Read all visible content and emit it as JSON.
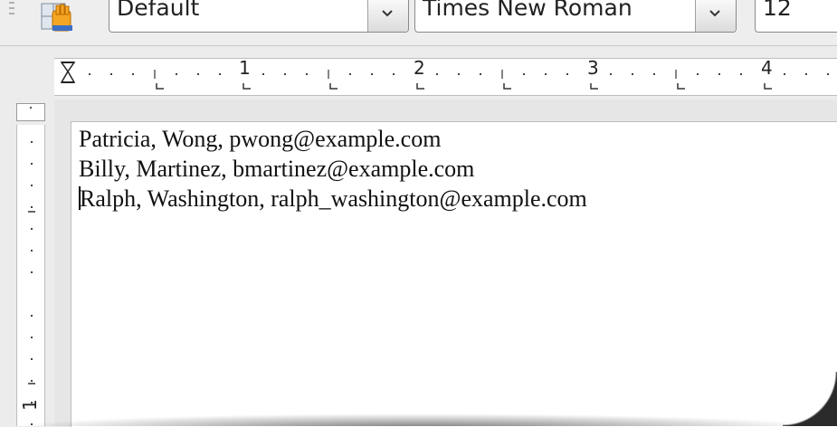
{
  "toolbar": {
    "paragraph_style": "Default",
    "font_name": "Times New Roman",
    "font_size": "12"
  },
  "ruler": {
    "horizontal_labels": [
      "1",
      "2",
      "3",
      "4"
    ],
    "vertical_labels": [
      "1"
    ]
  },
  "document": {
    "lines": [
      "Patricia, Wong, pwong@example.com",
      "Billy, Martinez, bmartinez@example.com",
      "Ralph, Washington, ralph_washington@example.com"
    ]
  },
  "icons": {
    "styles": "paragraph-styles-icon",
    "dropdown": "chevron-down-icon"
  }
}
